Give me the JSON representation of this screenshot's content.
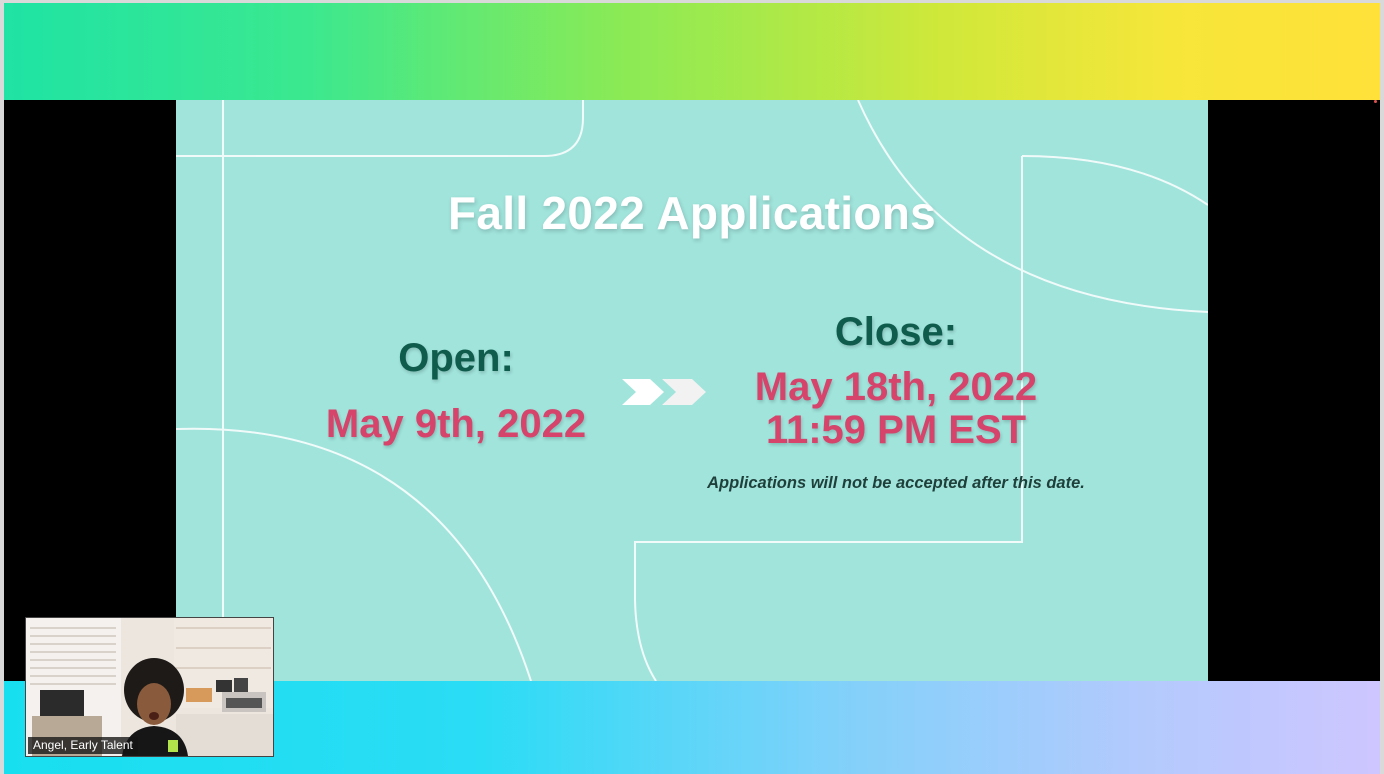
{
  "slide": {
    "title": "Fall 2022 Applications",
    "open_label": "Open:",
    "open_date": "May 9th, 2022",
    "close_label": "Close:",
    "close_date": "May 18th, 2022",
    "close_time": "11:59 PM EST",
    "note": "Applications will not be accepted after this date.",
    "arrow_icon": "double-chevron-right-icon",
    "colors": {
      "background": "#a0e4dc",
      "title": "#ffffff",
      "label": "#0f5b4c",
      "date": "#d6436b"
    }
  },
  "video": {
    "participant_name": "Angel, Early Talent"
  }
}
